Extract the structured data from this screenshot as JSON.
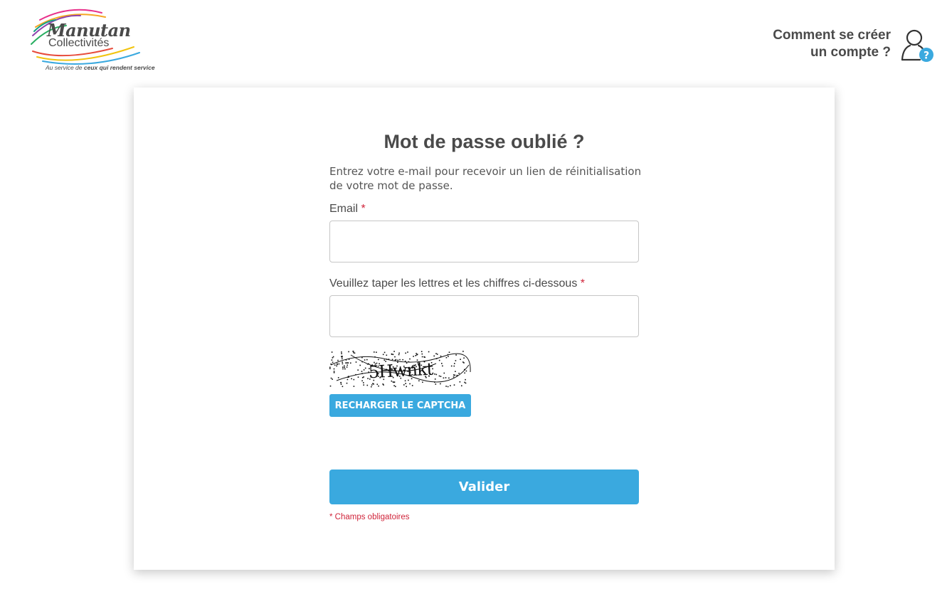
{
  "header": {
    "logo": {
      "brand": "Manutan",
      "sub": "Collectivités",
      "tagline_prefix": "Au service de ",
      "tagline_bold": "ceux qui rendent service"
    },
    "help_link": {
      "line1": "Comment se créer",
      "line2": "un compte ?",
      "icon": "user-question-icon"
    }
  },
  "form": {
    "title": "Mot de passe oublié ?",
    "intro": "Entrez votre e-mail pour recevoir un lien de réinitialisation de votre mot de passe.",
    "email_label": "Email",
    "email_value": "",
    "captcha_label": "Veuillez taper les lettres et les chiffres ci-dessous",
    "captcha_value": "",
    "required_mark": "*",
    "reload_label": "RECHARGER LE CAPTCHA",
    "submit_label": "Valider",
    "required_note": "* Champs obligatoires"
  },
  "colors": {
    "accent": "#3aa9df",
    "required": "#d0243a",
    "text": "#4a4a4a"
  }
}
